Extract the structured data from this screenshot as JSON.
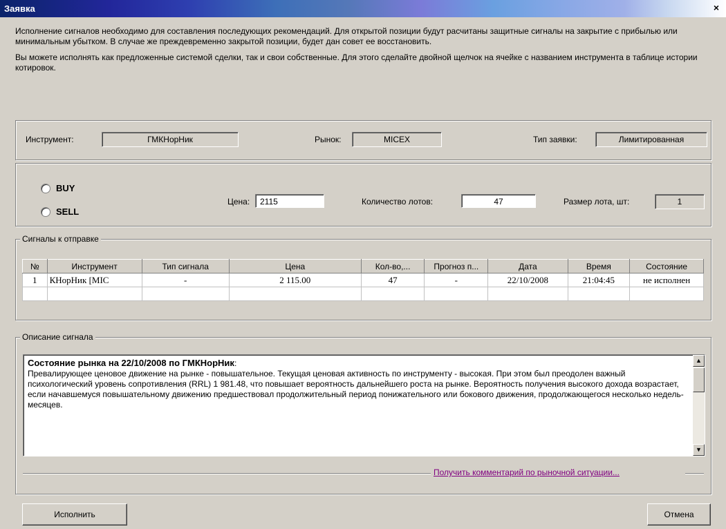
{
  "window": {
    "title": "Заявка",
    "close_glyph": "×"
  },
  "intro": {
    "paragraph1": "Исполнение сигналов необходимо для составления последующих рекомендаций. Для открытой позиции будут расчитаны защитные сигналы на закрытие с прибылью или минимальным убытком. В случае же преждевременно закрытой позиции, будет дан совет ее восстановить.",
    "paragraph2": "Вы можете исполнять как предложенные системой сделки, так и свои собственные. Для этого сделайте двойной щелчок на ячейке с названием инструмента в таблице истории котировок."
  },
  "instrument_box": {
    "instrument_label": "Инструмент:",
    "instrument_value": "ГМКНорНик",
    "market_label": "Рынок:",
    "market_value": "MICEX",
    "order_type_label": "Тип заявки:",
    "order_type_value": "Лимитированная"
  },
  "order_box": {
    "buy_label": "BUY",
    "sell_label": "SELL",
    "price_label": "Цена:",
    "price_value": "2115",
    "lots_label": "Количество лотов:",
    "lots_value": "47",
    "lot_size_label": "Размер лота, шт:",
    "lot_size_value": "1"
  },
  "signals": {
    "legend": "Сигналы к отправке",
    "columns": [
      "№",
      "Инструмент",
      "Тип сигнала",
      "Цена",
      "Кол-во,...",
      "Прогноз п...",
      "Дата",
      "Время",
      "Состояние"
    ],
    "rows": [
      [
        "1",
        "КНорНик [MIC",
        "-",
        "2 115.00",
        "47",
        "-",
        "22/10/2008",
        "21:04:45",
        "не исполнен"
      ]
    ]
  },
  "description": {
    "legend": "Описание сигнала",
    "heading": "Состояние рынка на 22/10/2008 по ГМКНорНик",
    "heading_suffix": ":",
    "body": "Превалирующее ценовое движение на рынке - повышательное.  Текущая ценовая активность по инструменту - высокая. При этом был преодолен важный психологический уровень сопротивления (RRL) 1 981.48, что повышает вероятность дальнейшего роста на рынке. Вероятность получения высокого дохода возрастает, если начавшемуся повышательному движению предшествовал продолжительный период понижательного или бокового движения, продолжающегося несколько недель-месяцев.",
    "link": "Получить комментарий по рыночной ситуации...",
    "scroll_up": "▲",
    "scroll_down": "▼"
  },
  "buttons": {
    "execute": "Исполнить",
    "cancel": "Отмена"
  }
}
